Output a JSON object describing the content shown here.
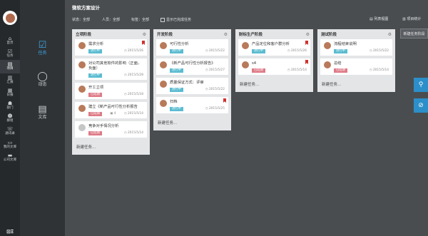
{
  "leftnav": {
    "items": [
      {
        "label": "首页",
        "icon": "home-icon",
        "glyph": "⌂"
      },
      {
        "label": "任务",
        "icon": "task-check-icon",
        "glyph": "☑"
      },
      {
        "label": "项目",
        "icon": "project-icon",
        "glyph": "▤"
      },
      {
        "label": "汇报",
        "icon": "report-icon",
        "glyph": "▥"
      },
      {
        "label": "日报",
        "icon": "daily-report-icon",
        "glyph": "▦"
      },
      {
        "label": "部门",
        "icon": "department-icon",
        "glyph": "☗"
      },
      {
        "label": "群组",
        "icon": "group-icon",
        "glyph": "☻"
      },
      {
        "label": "通讯录",
        "icon": "contacts-icon",
        "glyph": "☏"
      },
      {
        "label": "我的文库",
        "icon": "my-library-icon",
        "glyph": "▭"
      },
      {
        "label": "公司文库",
        "icon": "company-library-icon",
        "glyph": "▬"
      }
    ],
    "active_index": 2,
    "brand": "⊡Ξ"
  },
  "subnav": {
    "items": [
      {
        "label": "任务",
        "icon": "task-check-icon",
        "glyph": "☑"
      },
      {
        "label": "动态",
        "icon": "chat-bubble-icon",
        "glyph": "◯"
      },
      {
        "label": "文库",
        "icon": "document-icon",
        "glyph": "▤"
      }
    ]
  },
  "header": {
    "title": "微软方案设计",
    "filters": {
      "status": "状态：全部",
      "person": "人员：全部",
      "tag": "标签：全部"
    },
    "show_done_label": "显示已完成任务",
    "list_view_label": "列表视图",
    "stats_label": "项目统计",
    "new_task_label": "新建任务阶段"
  },
  "columns": [
    {
      "title": "立项阶段",
      "new_task": "新建任务...",
      "cards": [
        {
          "title": "需求分析",
          "status": "进行中",
          "status_type": "run",
          "date": "2015/5/26",
          "flag": true
        },
        {
          "title": "对公司其他软件的影响（正面，负面）",
          "status": "进行中",
          "status_type": "run",
          "date": "2015/5/28",
          "flag": false
        },
        {
          "title": "开工立项",
          "status": "已延期",
          "status_type": "late",
          "date": "2015/5/18",
          "flag": false
        },
        {
          "title": "建立《新产品可行性分析报告",
          "status": "已延期",
          "status_type": "late",
          "date": "2015/5/14",
          "flag": false,
          "count": "4"
        },
        {
          "title": "竞争对手情况分析",
          "status": "已延期",
          "status_type": "late",
          "date": "2015/5/14",
          "flag": false,
          "gray": true
        }
      ]
    },
    {
      "title": "开发阶段",
      "new_task": "新建任务...",
      "cards": [
        {
          "title": "可行性分析",
          "status": "进行中",
          "status_type": "run",
          "date": "2015/5/22",
          "flag": false
        },
        {
          "title": "《新产品可行性分析报告》",
          "status": "进行中",
          "status_type": "run",
          "date": "2015/5/27",
          "flag": false
        },
        {
          "title": "质量保证方式：评审",
          "status": "进行中",
          "status_type": "run",
          "date": "2015/5/22",
          "flag": false
        },
        {
          "title": "扫档",
          "status": "进行中",
          "status_type": "run",
          "date": "2015/5/25",
          "flag": true
        }
      ]
    },
    {
      "title": "财标生产阶段",
      "new_task": "新建任务...",
      "cards": [
        {
          "title": "产品定位和客户群分析",
          "status": "进行中",
          "status_type": "run",
          "date": "2015/5/26",
          "flag": true
        },
        {
          "title": "s4",
          "status": "已延期",
          "status_type": "late",
          "date": "2015/5/14",
          "flag": true
        }
      ]
    },
    {
      "title": "测试阶段",
      "new_task": "新建任务...",
      "cards": [
        {
          "title": "流程结束说明",
          "status": "进行中",
          "status_type": "run",
          "date": "2015/5/22",
          "flag": false
        },
        {
          "title": "总结",
          "status": "已延期",
          "status_type": "late",
          "date": "2015/5/14",
          "flag": false
        }
      ]
    }
  ],
  "float_buttons": [
    {
      "icon": "search-icon",
      "glyph": "⚲"
    },
    {
      "icon": "unlink-icon",
      "glyph": "⊘"
    }
  ]
}
